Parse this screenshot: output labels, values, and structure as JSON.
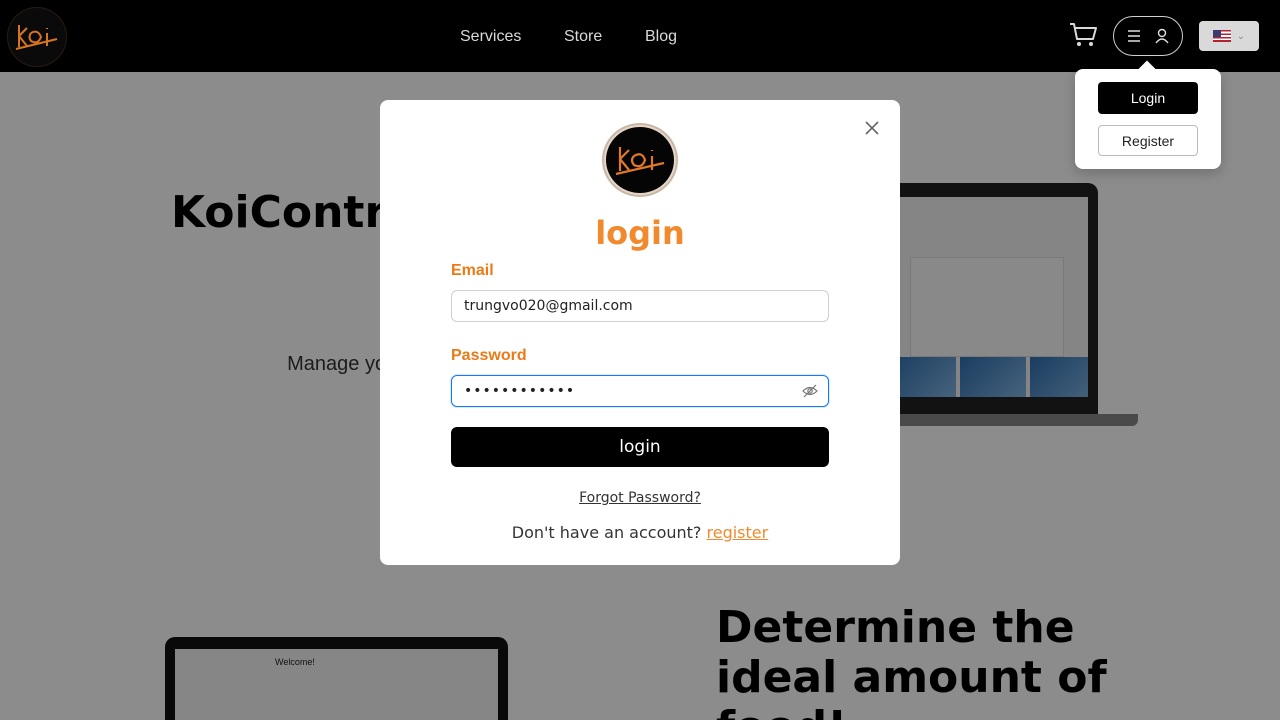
{
  "header": {
    "nav": [
      "Services",
      "Store",
      "Blog"
    ],
    "logo_text": "Koi"
  },
  "hero": {
    "title": "KoiControl Koi Web F",
    "subtitle": "Manage your water param your po"
  },
  "section2": {
    "title": "Determine the ideal amount of food!",
    "welcome": "Welcome!"
  },
  "dropdown": {
    "login": "Login",
    "register": "Register"
  },
  "modal": {
    "title": "login",
    "email_label": "Email",
    "email_value": "trungvo020@gmail.com",
    "password_label": "Password",
    "password_value": "••••••••••••",
    "submit": "login",
    "forgot": "Forgot Password?",
    "no_account": "Don't have an account?",
    "register_link": "register"
  },
  "colors": {
    "accent": "#f08a2c",
    "label": "#ec7a16",
    "focus": "#1677ff"
  }
}
